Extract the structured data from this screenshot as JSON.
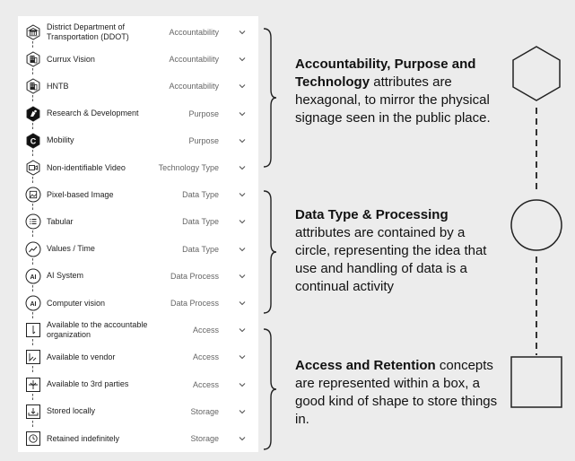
{
  "rows": [
    {
      "label": "District Department of Transportation (DDOT)",
      "category": "Accountability",
      "icon": "building-icon"
    },
    {
      "label": "Currux Vision",
      "category": "Accountability",
      "icon": "office-icon"
    },
    {
      "label": "HNTB",
      "category": "Accountability",
      "icon": "office-icon"
    },
    {
      "label": "Research & Development",
      "category": "Purpose",
      "icon": "research-icon"
    },
    {
      "label": "Mobility",
      "category": "Purpose",
      "icon": "mobility-icon"
    },
    {
      "label": "Non-identifiable Video",
      "category": "Technology Type",
      "icon": "video-camera-icon"
    },
    {
      "label": "Pixel-based Image",
      "category": "Data Type",
      "icon": "image-icon"
    },
    {
      "label": "Tabular",
      "category": "Data Type",
      "icon": "list-icon"
    },
    {
      "label": "Values / Time",
      "category": "Data Type",
      "icon": "trend-icon"
    },
    {
      "label": "AI System",
      "category": "Data Process",
      "icon": "ai-icon"
    },
    {
      "label": "Computer vision",
      "category": "Data Process",
      "icon": "ai-icon"
    },
    {
      "label": "Available to the accountable organization",
      "category": "Access",
      "icon": "access-org-icon"
    },
    {
      "label": "Available to vendor",
      "category": "Access",
      "icon": "access-vendor-icon"
    },
    {
      "label": "Available to 3rd parties",
      "category": "Access",
      "icon": "access-third-party-icon"
    },
    {
      "label": "Stored locally",
      "category": "Storage",
      "icon": "storage-local-icon"
    },
    {
      "label": "Retained indefinitely",
      "category": "Storage",
      "icon": "clock-icon"
    }
  ],
  "groups": [
    {
      "bold": "Accountability, Purpose and Technology",
      "text": " attributes are hexagonal, to mirror the physical signage seen in the public place.",
      "shape": "hexagon-icon"
    },
    {
      "bold": "Data Type & Processing",
      "text": " attributes are contained by a circle, representing the idea that use and handling of data is a continual activity",
      "shape": "circle-icon"
    },
    {
      "bold": "Access and Retention",
      "text": " concepts are represented within a box, a good kind of shape to store things in.",
      "shape": "square-icon"
    }
  ],
  "colors": {
    "background": "#ececec",
    "panel": "#ffffff",
    "ink": "#111111",
    "muted": "#666666",
    "filled_hex": "#111111"
  }
}
